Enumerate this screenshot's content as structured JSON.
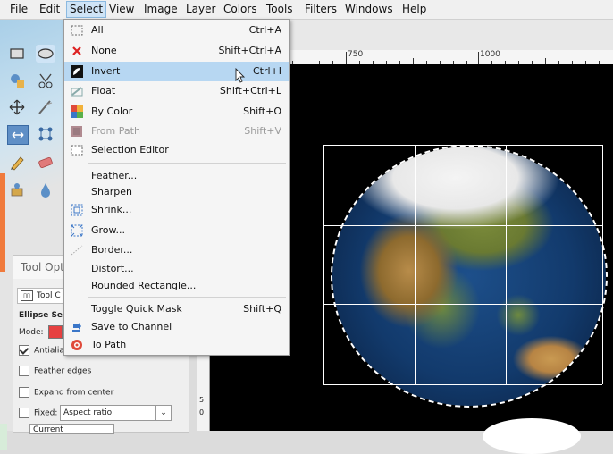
{
  "menubar": {
    "items": [
      "File",
      "Edit",
      "Select",
      "View",
      "Image",
      "Layer",
      "Colors",
      "Tools",
      "Filters",
      "Windows",
      "Help"
    ]
  },
  "select_menu": {
    "items": [
      {
        "label": "All",
        "shortcut": "Ctrl+A",
        "icon": "select-all-icon"
      },
      {
        "label": "None",
        "shortcut": "Shift+Ctrl+A",
        "icon": "select-none-icon"
      },
      {
        "label": "Invert",
        "shortcut": "Ctrl+I",
        "icon": "invert-selection-icon"
      },
      {
        "label": "Float",
        "shortcut": "Shift+Ctrl+L",
        "icon": "float-icon"
      },
      {
        "label": "By Color",
        "shortcut": "Shift+O",
        "icon": "by-color-icon"
      },
      {
        "label": "From Path",
        "shortcut": "Shift+V",
        "icon": "from-path-icon"
      },
      {
        "label": "Selection Editor",
        "shortcut": "",
        "icon": "selection-editor-icon"
      },
      {
        "label": "Feather...",
        "shortcut": "",
        "icon": ""
      },
      {
        "label": "Sharpen",
        "shortcut": "",
        "icon": ""
      },
      {
        "label": "Shrink...",
        "shortcut": "",
        "icon": "shrink-icon"
      },
      {
        "label": "Grow...",
        "shortcut": "",
        "icon": "grow-icon"
      },
      {
        "label": "Border...",
        "shortcut": "",
        "icon": "border-icon"
      },
      {
        "label": "Distort...",
        "shortcut": "",
        "icon": ""
      },
      {
        "label": "Rounded Rectangle...",
        "shortcut": "",
        "icon": ""
      },
      {
        "label": "Toggle Quick Mask",
        "shortcut": "Shift+Q",
        "icon": ""
      },
      {
        "label": "Save to Channel",
        "shortcut": "",
        "icon": "save-to-channel-icon"
      },
      {
        "label": "To Path",
        "shortcut": "",
        "icon": "to-path-icon"
      }
    ]
  },
  "ruler": {
    "labels": [
      "750",
      "1000"
    ],
    "v_labels": [
      "5",
      "0"
    ]
  },
  "tool_options": {
    "tab_label": "Tool Opt",
    "header_label": "Tool C",
    "ellipse_label": "Ellipse Sele",
    "mode_label": "Mode:",
    "antialias_label": "Antialia",
    "feather_label": "Feather edges",
    "expand_label": "Expand from center",
    "fixed_label": "Fixed:",
    "fixed_value": "Aspect ratio",
    "current_label": "Current"
  },
  "colors": {
    "accent": "#b7d7f2",
    "menu_active": "#cfe4f6",
    "canvas": "#000000",
    "orange": "#f07a3c"
  }
}
